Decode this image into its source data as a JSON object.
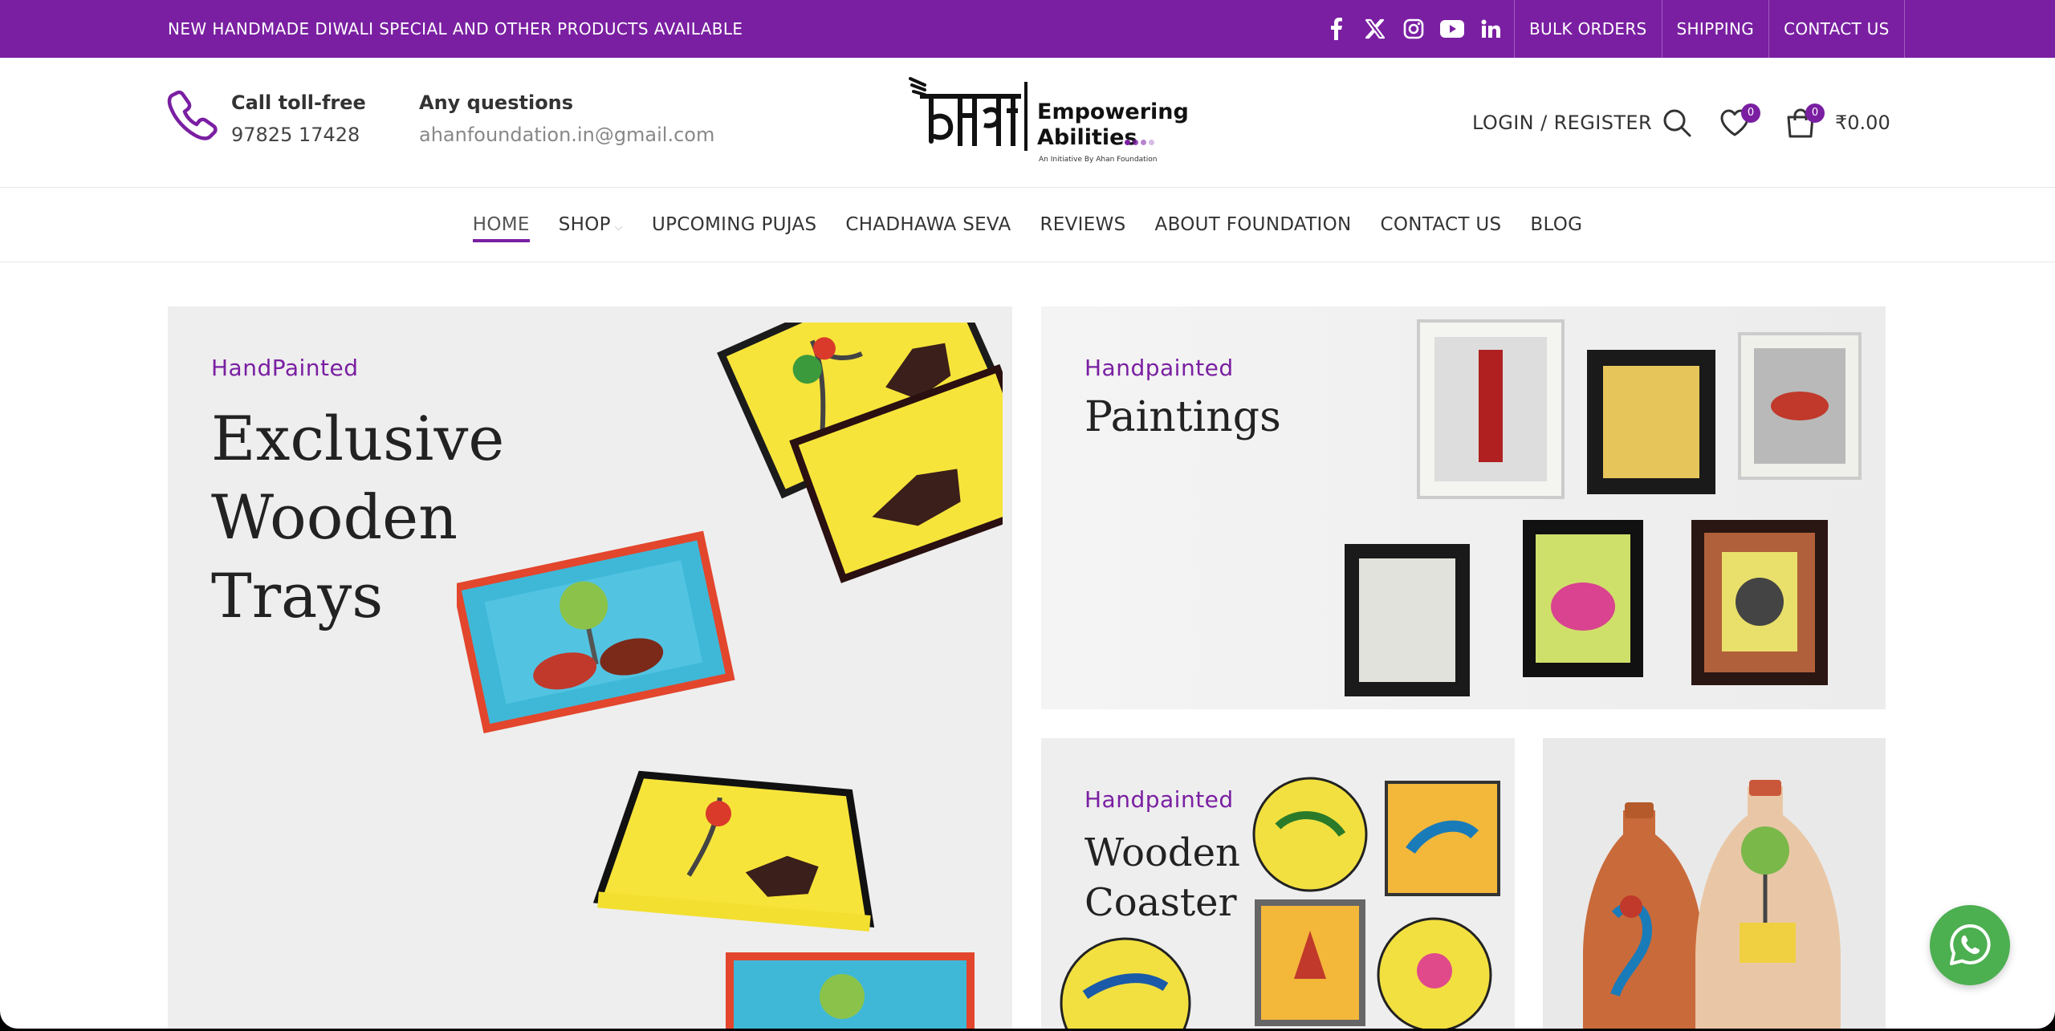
{
  "topbar": {
    "promo": "NEW HANDMADE DIWALI SPECIAL AND OTHER PRODUCTS AVAILABLE",
    "links": [
      "BULK ORDERS",
      "SHIPPING",
      "CONTACT US"
    ]
  },
  "header": {
    "call_title": "Call toll-free",
    "call_number": "97825 17428",
    "questions_title": "Any questions",
    "email": "ahanfoundation.in@gmail.com",
    "logo_tag_line1": "Empowering",
    "logo_tag_line2": "Abilities",
    "logo_sub": "An Initiative By Ahan Foundation",
    "login": "LOGIN / REGISTER",
    "wishlist_count": "0",
    "cart_count": "0",
    "cart_total": "₹0.00"
  },
  "nav": {
    "items": [
      "HOME",
      "SHOP",
      "UPCOMING PUJAS",
      "CHADHAWA SEVA",
      "REVIEWS",
      "ABOUT FOUNDATION",
      "CONTACT US",
      "BLOG"
    ]
  },
  "banners": [
    {
      "kicker": "HandPainted",
      "title_line1": "Exclusive",
      "title_line2": "Wooden",
      "title_line3": "Trays"
    },
    {
      "kicker": "Handpainted",
      "title_line1": "Paintings"
    },
    {
      "kicker": "Handpainted",
      "title_line1": "Wooden",
      "title_line2": "Coaster"
    }
  ],
  "colors": {
    "brand": "#7a1fa2",
    "whatsapp": "#4caf50"
  }
}
